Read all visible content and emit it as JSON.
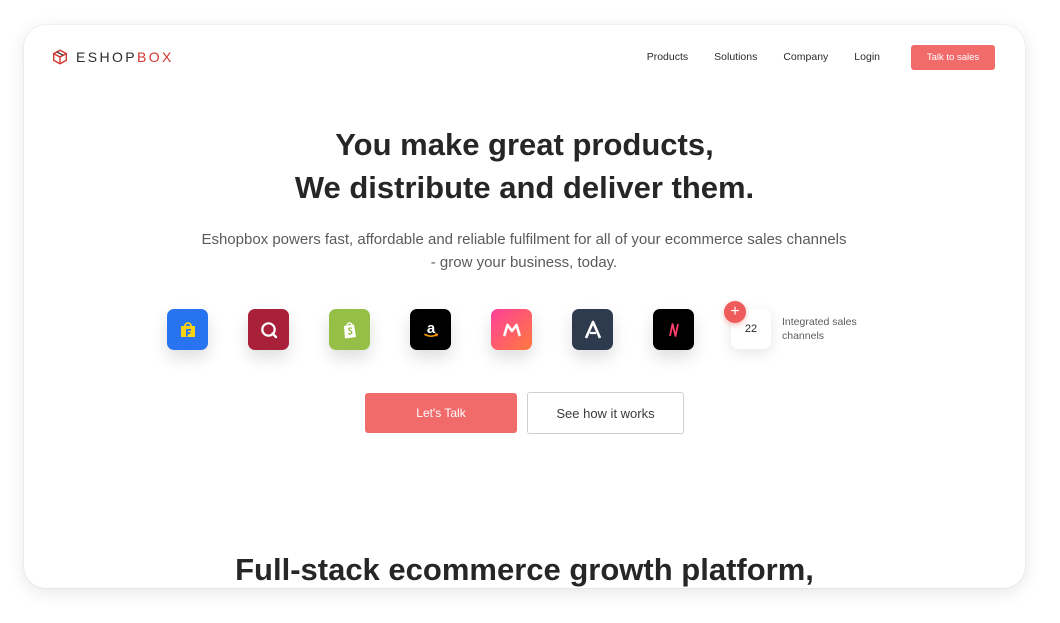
{
  "nav": {
    "logo": {
      "part1": "ESHOP",
      "part2": "BOX",
      "icon": "cube-icon"
    },
    "links": [
      "Products",
      "Solutions",
      "Company",
      "Login"
    ],
    "cta_label": "Talk to sales"
  },
  "hero": {
    "title_line1": "You make great products,",
    "title_line2": "We distribute and deliver them.",
    "subtitle_line1": "Eshopbox powers fast, affordable and reliable fulfilment for all of your ecommerce sales channels",
    "subtitle_line2": "- grow your business, today."
  },
  "channels": {
    "icons": [
      {
        "name": "flipkart-icon",
        "color": "#2874f0"
      },
      {
        "name": "quill-icon",
        "color": "#a8203a"
      },
      {
        "name": "shopify-icon",
        "color": "#95bf47"
      },
      {
        "name": "amazon-icon",
        "color": "#000000"
      },
      {
        "name": "myntra-icon",
        "color": "#ff3f6c"
      },
      {
        "name": "arrow-a-icon",
        "color": "#2e3a4d"
      },
      {
        "name": "nykaa-icon",
        "color": "#000000"
      }
    ],
    "more_count": "22",
    "plus_symbol": "+",
    "label": "Integrated sales channels"
  },
  "actions": {
    "primary": "Let's Talk",
    "secondary": "See how it works"
  },
  "section": {
    "title": "Full-stack ecommerce growth platform,"
  },
  "colors": {
    "accent": "#f26b6b",
    "brand_red": "#d2362f"
  }
}
